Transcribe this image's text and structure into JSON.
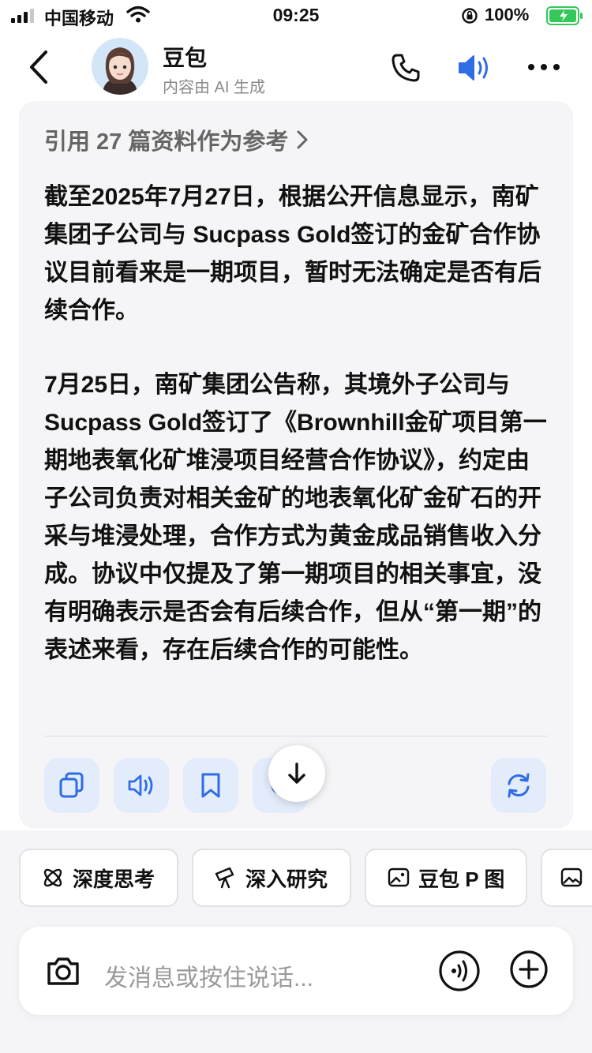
{
  "status_bar": {
    "carrier": "中国移动",
    "time": "09:25",
    "battery": "100%"
  },
  "header": {
    "name": "豆包",
    "subtitle": "内容由 AI 生成"
  },
  "message": {
    "citation": "引用 27 篇资料作为参考",
    "paragraph1": "截至2025年7月27日，根据公开信息显示，南矿集团子公司与 Sucpass Gold签订的金矿合作协议目前看来是一期项目，暂时无法确定是否有后续合作。",
    "paragraph2": "7月25日，南矿集团公告称，其境外子公司与 Sucpass Gold签订了《Brownhill金矿项目第一期地表氧化矿堆浸项目经营合作协议》，约定由子公司负责对相关金矿的地表氧化矿金矿石的开采与堆浸处理，合作方式为黄金成品销售收入分成。协议中仅提及了第一期项目的相关事宜，没有明确表示是否会有后续合作，但从“第一期”的表述来看，存在后续合作的可能性。",
    "actions": [
      "copy-icon",
      "speaker-icon",
      "bookmark-icon",
      "share-icon",
      "regenerate-icon"
    ]
  },
  "shortcuts": [
    {
      "label": "深度思考",
      "icon": "atom-icon"
    },
    {
      "label": "深入研究",
      "icon": "telescope-icon"
    },
    {
      "label": "豆包 P 图",
      "icon": "image-edit-icon"
    },
    {
      "label": "",
      "icon": "image-icon"
    }
  ],
  "input": {
    "placeholder": "发消息或按住说话..."
  },
  "colors": {
    "accent": "#2f6ce5",
    "card_bg": "#f5f5f7",
    "action_bg": "#e3ecfb",
    "battery_green": "#34c759"
  }
}
